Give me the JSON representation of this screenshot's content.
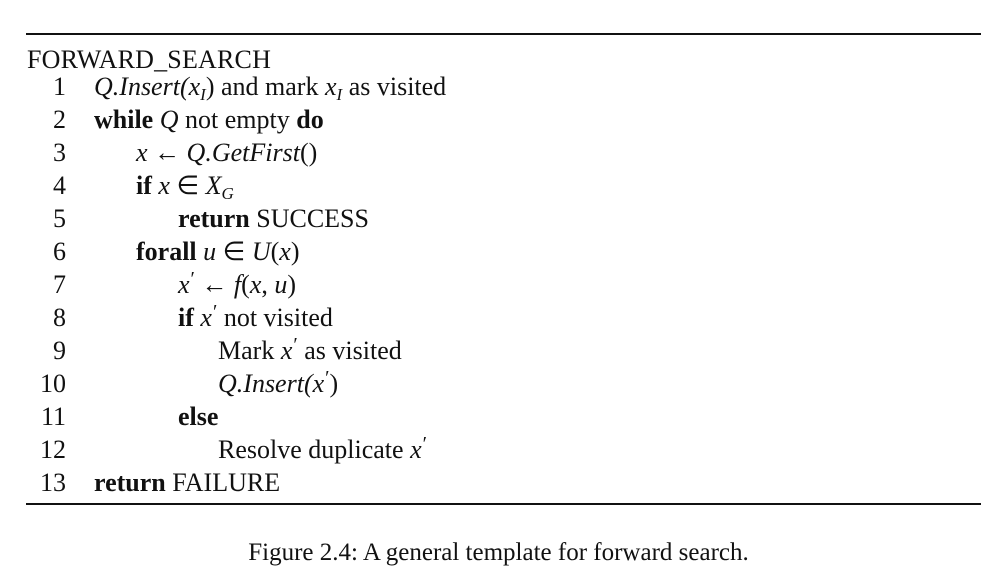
{
  "algorithm": {
    "title": "FORWARD_SEARCH",
    "line_numbers": [
      "1",
      "2",
      "3",
      "4",
      "5",
      "6",
      "7",
      "8",
      "9",
      "10",
      "11",
      "12",
      "13"
    ],
    "tokens": {
      "Q": "Q",
      "insert": ".Insert(",
      "x": "x",
      "sub_I": "I",
      "close_paren": ")",
      "and_mark": " and mark ",
      "as_visited": " as visited",
      "while": "while",
      "not_empty": " not empty ",
      "do": "do",
      "larrow": " ← ",
      "getfirst": ".GetFirst",
      "parens": "()",
      "if": "if",
      "elem": " ∈ ",
      "X": "X",
      "sub_G": "G",
      "return": "return",
      "success": " SUCCESS",
      "forall": "forall",
      "u": "u",
      "U": "U",
      "open_paren": "(",
      "prime": "′",
      "f": "f",
      "comma": ", ",
      "not_visited": " not visited",
      "mark": "Mark ",
      "else": "else",
      "resolve": "Resolve duplicate ",
      "failure": " FAILURE"
    }
  },
  "caption": "Figure 2.4: A general template for forward search."
}
